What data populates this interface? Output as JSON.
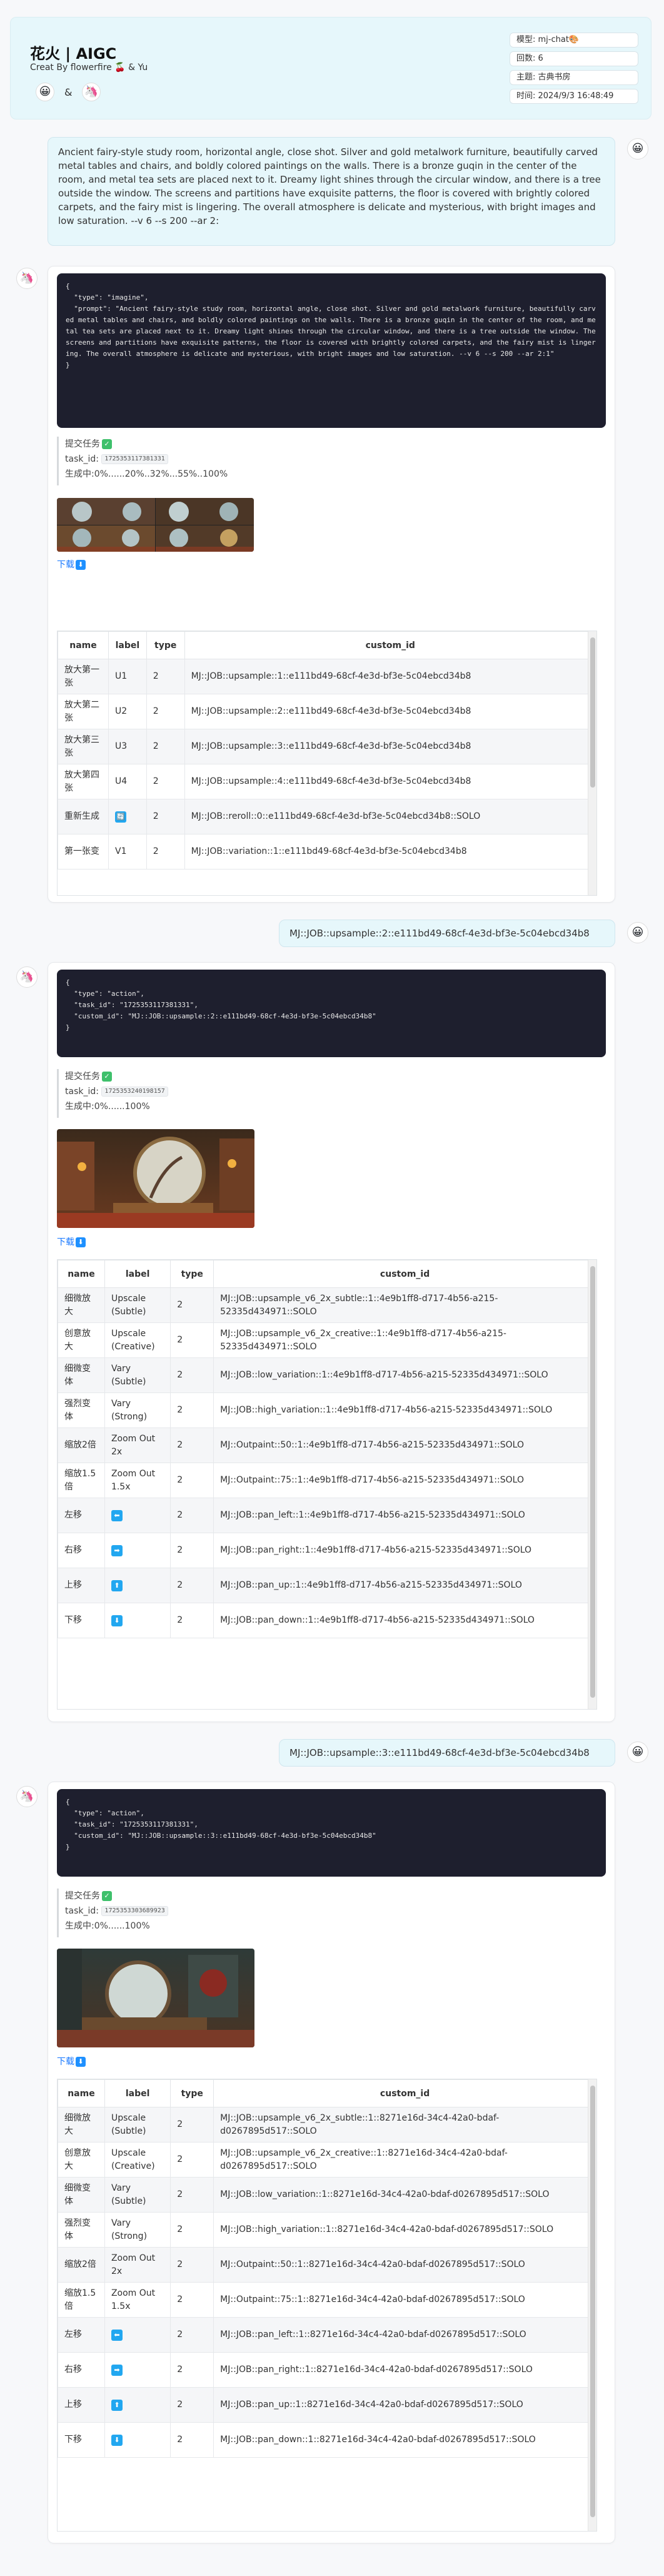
{
  "header": {
    "title": "花火 | AIGC",
    "subtitle": "Creat By flowerfire 🍒 & Yu",
    "emoji_user": "😀",
    "amp": "&",
    "emoji_bot": "🦄"
  },
  "meta": {
    "model": "模型: mj-chat🎨",
    "turns": "回数: 6",
    "topic": "主题: 古典书房",
    "time": "时间: 2024/9/3 16:48:49"
  },
  "user_avatar": "😀",
  "bot_avatar": "🦄",
  "prompt_text": "Ancient fairy-style study room, horizontal angle, close shot. Silver and gold metalwork furniture, beautifully carved metal tables and chairs, and boldly colored paintings on the walls. There is a bronze guqin in the center of the room, and metal tea sets are placed next to it. Dreamy light shines through the circular window, and there is a tree outside the window. The screens and partitions have exquisite patterns, the floor is covered with brightly colored carpets, and the fairy mist is lingering. The overall atmosphere is delicate and mysterious, with bright images and low saturation. --v 6 --s 200 --ar 2:",
  "cmd2": "MJ::JOB::upsample::2::e111bd49-68cf-4e3d-bf3e-5c04ebcd34b8",
  "cmd3": "MJ::JOB::upsample::3::e111bd49-68cf-4e3d-bf3e-5c04ebcd34b8",
  "labels": {
    "submit": "提交任务",
    "task_id": "task_id:",
    "download": "下载"
  },
  "r1": {
    "code": "{\n  \"type\": \"imagine\",\n  \"prompt\": \"Ancient fairy-style study room, horizontal angle, close shot. Silver and gold metalwork furniture, beautifully carved metal tables and chairs, and boldly colored paintings on the walls. There is a bronze guqin in the center of the room, and metal tea sets are placed next to it. Dreamy light shines through the circular window, and there is a tree outside the window. The screens and partitions have exquisite patterns, the floor is covered with brightly colored carpets, and the fairy mist is lingering. The overall atmosphere is delicate and mysterious, with bright images and low saturation. --v 6 --s 200 --ar 2:1\"\n}",
    "task_id": "1725353117381331",
    "progress": "生成中:0%......20%..32%...55%..100%",
    "headers": [
      "name",
      "label",
      "type",
      "custom_id"
    ],
    "rows": [
      [
        "放大第一张",
        "U1",
        "2",
        "MJ::JOB::upsample::1::e111bd49-68cf-4e3d-bf3e-5c04ebcd34b8"
      ],
      [
        "放大第二张",
        "U2",
        "2",
        "MJ::JOB::upsample::2::e111bd49-68cf-4e3d-bf3e-5c04ebcd34b8"
      ],
      [
        "放大第三张",
        "U3",
        "2",
        "MJ::JOB::upsample::3::e111bd49-68cf-4e3d-bf3e-5c04ebcd34b8"
      ],
      [
        "放大第四张",
        "U4",
        "2",
        "MJ::JOB::upsample::4::e111bd49-68cf-4e3d-bf3e-5c04ebcd34b8"
      ],
      [
        "重新生成",
        "🔄",
        "2",
        "MJ::JOB::reroll::0::e111bd49-68cf-4e3d-bf3e-5c04ebcd34b8::SOLO"
      ],
      [
        "第一张变",
        "V1",
        "2",
        "MJ::JOB::variation::1::e111bd49-68cf-4e3d-bf3e-5c04ebcd34b8"
      ]
    ]
  },
  "r2": {
    "code": "{\n  \"type\": \"action\",\n  \"task_id\": \"1725353117381331\",\n  \"custom_id\": \"MJ::JOB::upsample::2::e111bd49-68cf-4e3d-bf3e-5c04ebcd34b8\"\n}",
    "task_id": "1725353240198157",
    "progress": "生成中:0%......100%",
    "headers": [
      "name",
      "label",
      "type",
      "custom_id"
    ],
    "rows": [
      [
        "细微放大",
        "Upscale (Subtle)",
        "2",
        "MJ::JOB::upsample_v6_2x_subtle::1::4e9b1ff8-d717-4b56-a215-52335d434971::SOLO"
      ],
      [
        "创意放大",
        "Upscale (Creative)",
        "2",
        "MJ::JOB::upsample_v6_2x_creative::1::4e9b1ff8-d717-4b56-a215-52335d434971::SOLO"
      ],
      [
        "细微变体",
        "Vary (Subtle)",
        "2",
        "MJ::JOB::low_variation::1::4e9b1ff8-d717-4b56-a215-52335d434971::SOLO"
      ],
      [
        "强烈变体",
        "Vary (Strong)",
        "2",
        "MJ::JOB::high_variation::1::4e9b1ff8-d717-4b56-a215-52335d434971::SOLO"
      ],
      [
        "缩放2倍",
        "Zoom Out 2x",
        "2",
        "MJ::Outpaint::50::1::4e9b1ff8-d717-4b56-a215-52335d434971::SOLO"
      ],
      [
        "缩放1.5倍",
        "Zoom Out 1.5x",
        "2",
        "MJ::Outpaint::75::1::4e9b1ff8-d717-4b56-a215-52335d434971::SOLO"
      ],
      [
        "左移",
        "⬅️",
        "2",
        "MJ::JOB::pan_left::1::4e9b1ff8-d717-4b56-a215-52335d434971::SOLO"
      ],
      [
        "右移",
        "➡️",
        "2",
        "MJ::JOB::pan_right::1::4e9b1ff8-d717-4b56-a215-52335d434971::SOLO"
      ],
      [
        "上移",
        "⬆️",
        "2",
        "MJ::JOB::pan_up::1::4e9b1ff8-d717-4b56-a215-52335d434971::SOLO"
      ],
      [
        "下移",
        "⬇️",
        "2",
        "MJ::JOB::pan_down::1::4e9b1ff8-d717-4b56-a215-52335d434971::SOLO"
      ]
    ]
  },
  "r3": {
    "code": "{\n  \"type\": \"action\",\n  \"task_id\": \"1725353117381331\",\n  \"custom_id\": \"MJ::JOB::upsample::3::e111bd49-68cf-4e3d-bf3e-5c04ebcd34b8\"\n}",
    "task_id": "1725353303689923",
    "progress": "生成中:0%......100%",
    "headers": [
      "name",
      "label",
      "type",
      "custom_id"
    ],
    "rows": [
      [
        "细微放大",
        "Upscale (Subtle)",
        "2",
        "MJ::JOB::upsample_v6_2x_subtle::1::8271e16d-34c4-42a0-bdaf-d0267895d517::SOLO"
      ],
      [
        "创意放大",
        "Upscale (Creative)",
        "2",
        "MJ::JOB::upsample_v6_2x_creative::1::8271e16d-34c4-42a0-bdaf-d0267895d517::SOLO"
      ],
      [
        "细微变体",
        "Vary (Subtle)",
        "2",
        "MJ::JOB::low_variation::1::8271e16d-34c4-42a0-bdaf-d0267895d517::SOLO"
      ],
      [
        "强烈变体",
        "Vary (Strong)",
        "2",
        "MJ::JOB::high_variation::1::8271e16d-34c4-42a0-bdaf-d0267895d517::SOLO"
      ],
      [
        "缩放2倍",
        "Zoom Out 2x",
        "2",
        "MJ::Outpaint::50::1::8271e16d-34c4-42a0-bdaf-d0267895d517::SOLO"
      ],
      [
        "缩放1.5倍",
        "Zoom Out 1.5x",
        "2",
        "MJ::Outpaint::75::1::8271e16d-34c4-42a0-bdaf-d0267895d517::SOLO"
      ],
      [
        "左移",
        "⬅️",
        "2",
        "MJ::JOB::pan_left::1::8271e16d-34c4-42a0-bdaf-d0267895d517::SOLO"
      ],
      [
        "右移",
        "➡️",
        "2",
        "MJ::JOB::pan_right::1::8271e16d-34c4-42a0-bdaf-d0267895d517::SOLO"
      ],
      [
        "上移",
        "⬆️",
        "2",
        "MJ::JOB::pan_up::1::8271e16d-34c4-42a0-bdaf-d0267895d517::SOLO"
      ],
      [
        "下移",
        "⬇️",
        "2",
        "MJ::JOB::pan_down::1::8271e16d-34c4-42a0-bdaf-d0267895d517::SOLO"
      ]
    ]
  }
}
